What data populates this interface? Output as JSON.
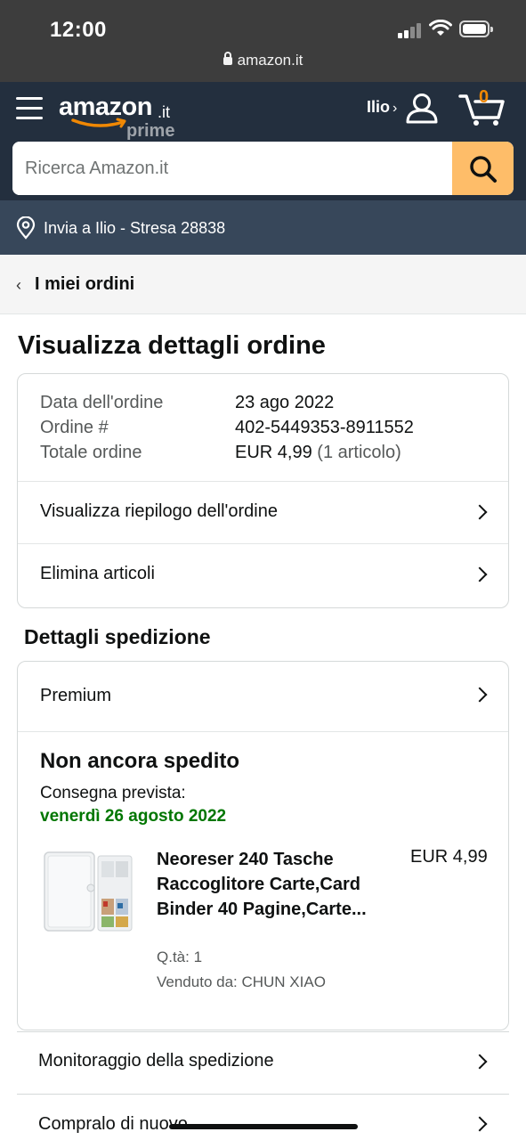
{
  "status_bar": {
    "time": "12:00",
    "url": "amazon.it"
  },
  "header": {
    "logo_word": "amazon",
    "logo_tld": ".it",
    "logo_sub": "prime",
    "account_name": "Ilio",
    "account_chevron": "›",
    "cart_count": "0",
    "search_placeholder": "Ricerca Amazon.it",
    "ship_to": "Invia a Ilio - Stresa 28838",
    "accent_color": "#febd69"
  },
  "nav": {
    "back_label": "I miei ordini"
  },
  "page": {
    "title": "Visualizza dettagli ordine"
  },
  "order_info": {
    "date_label": "Data dell'ordine",
    "date_value": "23 ago 2022",
    "number_label": "Ordine #",
    "number_value": "402-5449353-8911552",
    "total_label": "Totale ordine",
    "total_value": "EUR 4,99",
    "total_items": "(1 articolo)",
    "summary_link": "Visualizza riepilogo dell'ordine",
    "remove_link": "Elimina articoli"
  },
  "shipment": {
    "section_title": "Dettagli spedizione",
    "shipping_speed": "Premium",
    "status": "Non ancora spedito",
    "delivery_label": "Consegna prevista:",
    "delivery_date": "venerdì 26 agosto 2022",
    "delivery_color": "#007600",
    "item": {
      "title": "Neoreser 240 Tasche Raccoglitore Carte,Card Binder 40 Pagine,Carte...",
      "price": "EUR 4,99",
      "qty": "Q.tà: 1",
      "seller": "Venduto da: CHUN XIAO"
    }
  },
  "actions": {
    "track": "Monitoraggio della spedizione",
    "buy_again": "Compralo di nuovo"
  },
  "icons": [
    "menu-icon",
    "user-icon",
    "cart-icon",
    "search-icon",
    "location-pin-icon",
    "chevron-left-icon",
    "chevron-right-icon",
    "lock-icon"
  ]
}
